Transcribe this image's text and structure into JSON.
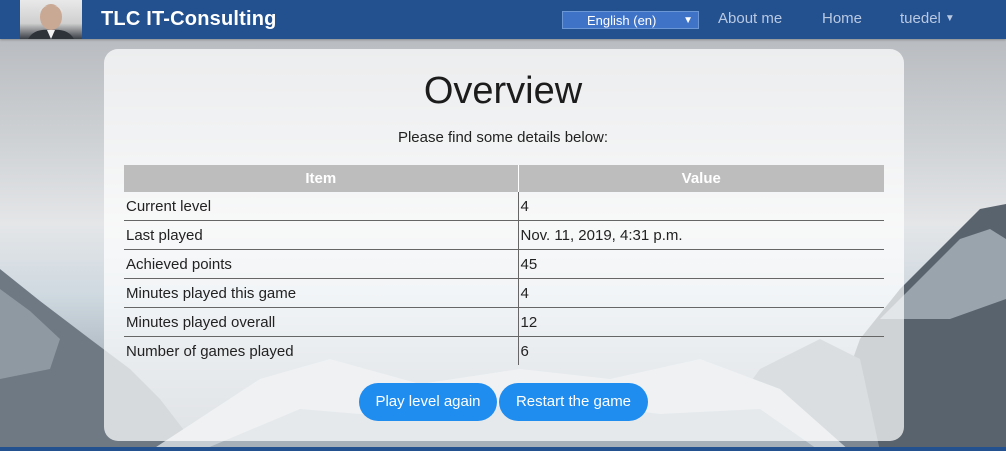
{
  "navbar": {
    "brand": "TLC IT-Consulting",
    "language": "English (en)",
    "links": {
      "about": "About me",
      "home": "Home",
      "user": "tuedel"
    },
    "colors": {
      "background": "#23508f",
      "link": "#b9c9e2"
    }
  },
  "overview": {
    "title": "Overview",
    "subtitle": "Please find some details below:",
    "table": {
      "headers": [
        "Item",
        "Value"
      ],
      "rows": [
        [
          "Current level",
          "4"
        ],
        [
          "Last played",
          "Nov. 11, 2019, 4:31 p.m."
        ],
        [
          "Achieved points",
          "45"
        ],
        [
          "Minutes played this game",
          "4"
        ],
        [
          "Minutes played overall",
          "12"
        ],
        [
          "Number of games played",
          "6"
        ]
      ]
    },
    "buttons": {
      "play_again": "Play level again",
      "restart": "Restart the game"
    },
    "colors": {
      "button": "#1f8cf0",
      "header": "#bdbdbd"
    }
  }
}
